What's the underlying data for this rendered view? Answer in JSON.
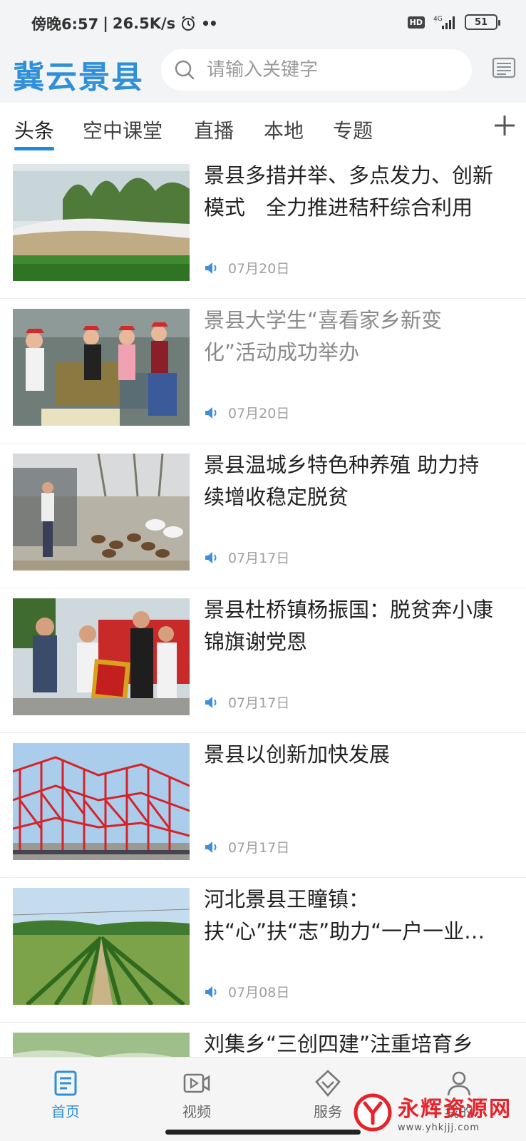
{
  "status_bar": {
    "time": "傍晚6:57",
    "speed": "26.5K/s",
    "network": "4G",
    "hd": "HD",
    "battery": "51"
  },
  "header": {
    "app_title": "冀云景县",
    "search_placeholder": "请输入关键字"
  },
  "tabs": [
    {
      "label": "头条",
      "active": true
    },
    {
      "label": "空中课堂"
    },
    {
      "label": "直播"
    },
    {
      "label": "本地"
    },
    {
      "label": "专题"
    }
  ],
  "feed": [
    {
      "title_l1": "景县多措并举、多点发力、创新",
      "title_l2": "模式　全力推进秸秆综合利用",
      "date": "07月20日",
      "read": false
    },
    {
      "title_l1": "景县大学生“喜看家乡新变",
      "title_l2": "化”活动成功举办",
      "date": "07月20日",
      "read": true
    },
    {
      "title_l1": "景县温城乡特色种养殖 助力持",
      "title_l2": "续增收稳定脱贫",
      "date": "07月17日",
      "read": false
    },
    {
      "title_l1": "景县杜桥镇杨振国：脱贫奔小康",
      "title_l2": "锦旗谢党恩",
      "date": "07月17日",
      "read": false
    },
    {
      "title_l1": "景县以创新加快发展",
      "title_l2": "",
      "date": "07月17日",
      "read": false
    },
    {
      "title_l1": "河北景县王瞳镇：",
      "title_l2": "扶“心”扶“志”助力“一户一业…",
      "date": "07月08日",
      "read": false
    },
    {
      "title_l1": "刘集乡“三创四建”注重培育乡",
      "title_l2": "",
      "date": "",
      "read": false
    }
  ],
  "bottom_nav": [
    {
      "label": "首页",
      "icon": "home-icon",
      "active": true
    },
    {
      "label": "视频",
      "icon": "video-icon"
    },
    {
      "label": "服务",
      "icon": "service-icon"
    },
    {
      "label": "我的",
      "icon": "profile-icon"
    }
  ],
  "watermark": {
    "name": "永辉资源网",
    "url": "www.yhkjjj.com"
  },
  "colors": {
    "accent": "#2f8fd8",
    "watermark_red": "#e6232a"
  }
}
